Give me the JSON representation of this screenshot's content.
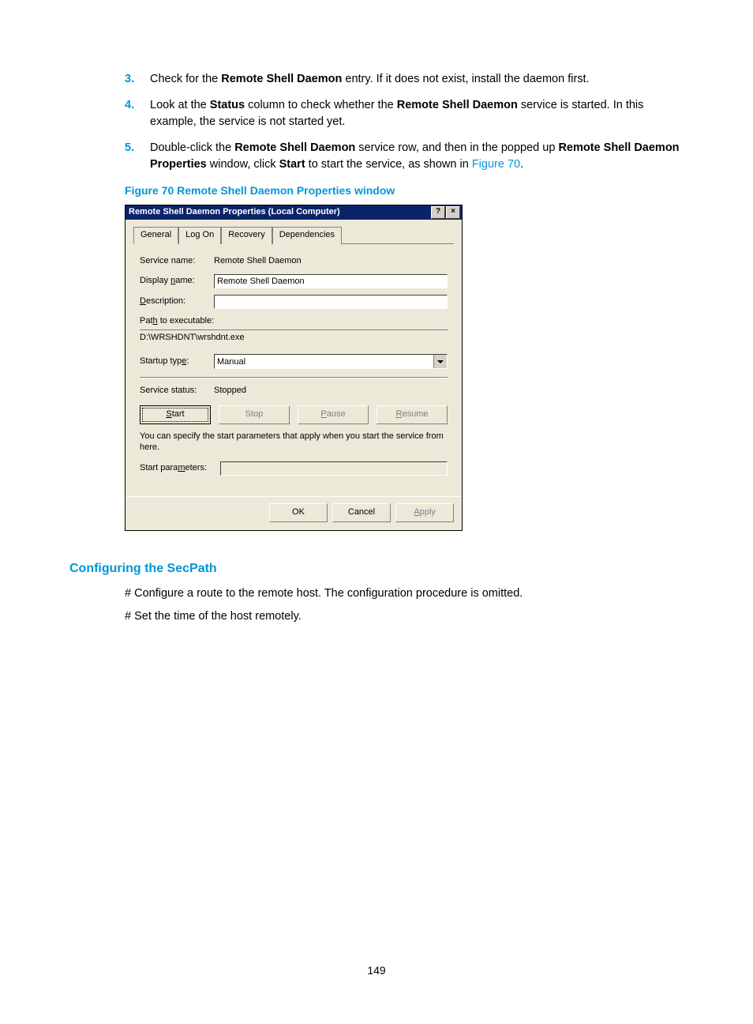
{
  "steps": [
    {
      "num": "3.",
      "pre": "Check for the ",
      "b1": "Remote Shell Daemon",
      "post": " entry. If it does not exist, install the daemon first."
    },
    {
      "num": "4.",
      "pre": "Look at the ",
      "b1": "Status",
      "mid": " column to check whether the ",
      "b2": "Remote Shell Daemon",
      "post": " service is started. In this example, the service is not started yet."
    },
    {
      "num": "5.",
      "pre": "Double-click the ",
      "b1": "Remote Shell Daemon",
      "mid": " service row, and then in the popped up ",
      "b2": "Remote Shell Daemon Properties",
      "mid2": " window, click ",
      "b3": "Start",
      "post": " to start the service, as shown in ",
      "link": "Figure 70",
      "post2": "."
    }
  ],
  "figcap": "Figure 70 Remote Shell Daemon Properties window",
  "dialog": {
    "title": "Remote Shell Daemon Properties (Local Computer)",
    "help": "?",
    "close": "×",
    "tabs": [
      "General",
      "Log On",
      "Recovery",
      "Dependencies"
    ],
    "fields": {
      "service_name_label": "Service name:",
      "service_name_value": "Remote Shell Daemon",
      "display_name_label": "Display name:",
      "display_name_label_u": "n",
      "display_name_value": "Remote Shell Daemon",
      "description_label": "Description:",
      "description_label_u": "D",
      "description_value": "",
      "path_label": "Path to executable:",
      "path_label_u": "h",
      "path_value": "D:\\WRSHDNT\\wrshdnt.exe",
      "startup_label": "Startup type:",
      "startup_label_u": "e",
      "startup_value": "Manual",
      "status_label": "Service status:",
      "status_value": "Stopped",
      "note": "You can specify the start parameters that apply when you start the service from here.",
      "startparam_label": "Start parameters:",
      "startparam_label_u": "m",
      "startparam_value": ""
    },
    "svc_buttons": {
      "start": "Start",
      "start_u": "S",
      "stop": "Stop",
      "stop_u": "",
      "pause": "Pause",
      "pause_u": "P",
      "resume": "Resume",
      "resume_u": "R"
    },
    "footer": {
      "ok": "OK",
      "cancel": "Cancel",
      "apply": "Apply",
      "apply_u": "A"
    }
  },
  "h3": "Configuring the SecPath",
  "para1": "# Configure a route to the remote host. The configuration procedure is omitted.",
  "para2": "# Set the time of the host remotely.",
  "pagenum": "149"
}
